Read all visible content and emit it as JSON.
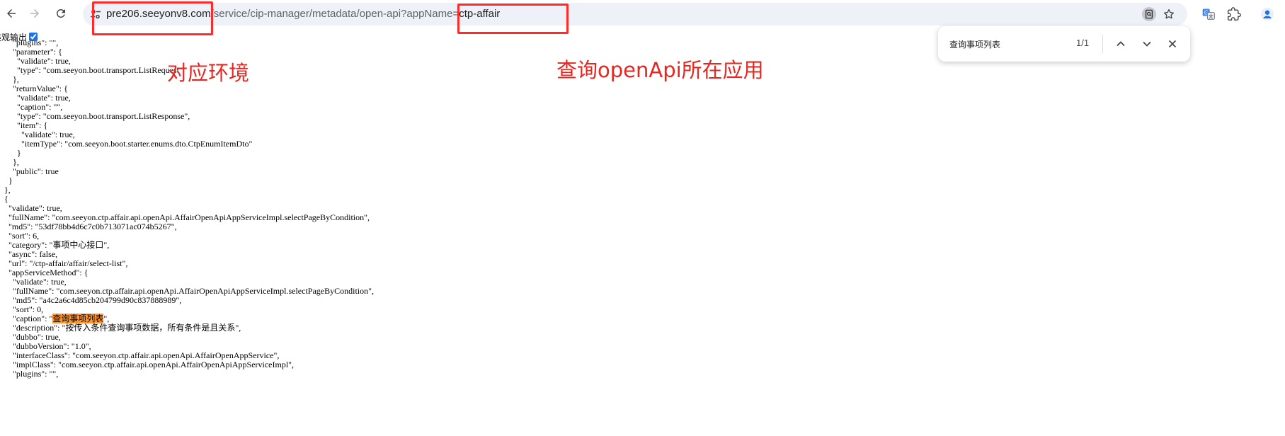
{
  "browser": {
    "url": {
      "host": "pre206.seeyonv8.com",
      "path": "/service/cip-manager/metadata/open-api?appName=",
      "query_value": "ctp-affair"
    },
    "icons": {
      "back": "back-arrow-icon",
      "forward": "forward-arrow-icon",
      "reload": "reload-icon",
      "site_info": "tune-icon",
      "find_in_page": "find-in-page-icon",
      "bookmark": "star-icon",
      "translate": "translate-icon",
      "extensions": "puzzle-icon",
      "profile": "avatar-icon"
    }
  },
  "pretty_print": {
    "label": "美观输出",
    "checked": true
  },
  "find_bar": {
    "query": "查询事项列表",
    "count": "1/1"
  },
  "annotations": {
    "environment_label": "对应环境",
    "app_label": "查询openApi所在应用"
  },
  "json_lines": [
    "      \"plugins\": \"\",",
    "      \"parameter\": {",
    "        \"validate\": true,",
    "        \"type\": \"com.seeyon.boot.transport.ListRequest\"",
    "      },",
    "      \"returnValue\": {",
    "        \"validate\": true,",
    "        \"caption\": \"\",",
    "        \"type\": \"com.seeyon.boot.transport.ListResponse\",",
    "        \"item\": {",
    "          \"validate\": true,",
    "          \"itemType\": \"com.seeyon.boot.starter.enums.dto.CtpEnumItemDto\"",
    "        }",
    "      },",
    "      \"public\": true",
    "    }",
    "  },",
    "  {",
    "    \"validate\": true,",
    "    \"fullName\": \"com.seeyon.ctp.affair.api.openApi.AffairOpenApiAppServiceImpl.selectPageByCondition\",",
    "    \"md5\": \"53df78bb4d6c7c0b713071ac074b5267\",",
    "    \"sort\": 6,",
    "    \"category\": \"事项中心接口\",",
    "    \"async\": false,",
    "    \"url\": \"/ctp-affair/affair/select-list\",",
    "    \"appServiceMethod\": {",
    "      \"validate\": true,",
    "      \"fullName\": \"com.seeyon.ctp.affair.api.openApi.AffairOpenApiAppServiceImpl.selectPageByCondition\",",
    "      \"md5\": \"a4c2a6c4d85cb204799d90c837888989\",",
    "      \"sort\": 0,",
    "      \"caption\": \"",
    "      \"description\": \"按传入条件查询事项数据，所有条件是且关系\",",
    "      \"dubbo\": true,",
    "      \"dubboVersion\": \"1.0\",",
    "      \"interfaceClass\": \"com.seeyon.ctp.affair.api.openApi.AffairOpenAppService\",",
    "      \"implClass\": \"com.seeyon.ctp.affair.api.openApi.AffairOpenApiAppServiceImpl\",",
    "      \"plugins\": \"\","
  ],
  "caption_match": "查询事项列表",
  "caption_suffix": "\","
}
